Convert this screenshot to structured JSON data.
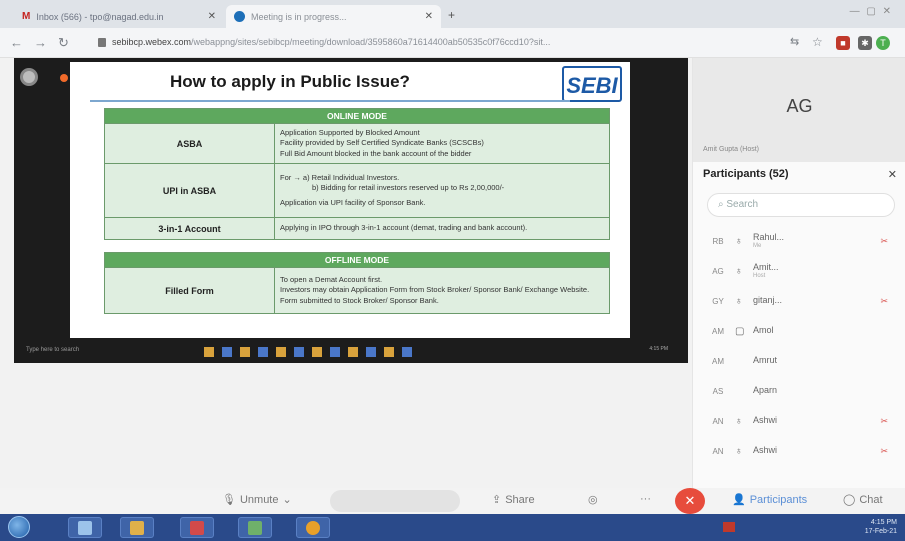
{
  "browser": {
    "tabs": [
      {
        "label": "Inbox (566) - tpo@nagad.edu.in"
      },
      {
        "label": "Meeting is in progress..."
      }
    ],
    "url_host": "sebibcp.webex.com",
    "url_path": "/webappng/sites/sebibcp/meeting/download/3595860a71614400ab50535c0f76ccd10?sit...",
    "profile_initial": "T"
  },
  "slide": {
    "title": "How to apply in Public Issue?",
    "logo_text": "SEBI",
    "online": {
      "heading": "ONLINE MODE",
      "rows": [
        {
          "key": "ASBA",
          "lines": [
            "Application Supported by Blocked Amount",
            "Facility provided by Self Certified Syndicate Banks (SCSCBs)",
            "Full Bid Amount blocked in the bank account of the bidder"
          ]
        },
        {
          "key": "UPI in ASBA",
          "lines": [
            "For →  a)  Retail Individual Investors.",
            "b)  Bidding for retail investors reserved up to Rs 2,00,000/-",
            "Application via UPI facility of Sponsor Bank."
          ]
        },
        {
          "key": "3-in-1 Account",
          "lines": [
            "Applying in IPO through 3-in-1 account (demat, trading and bank account)."
          ]
        }
      ]
    },
    "offline": {
      "heading": "OFFLINE MODE",
      "rows": [
        {
          "key": "Filled Form",
          "lines": [
            "To open a Demat Account first.",
            "Investors may obtain Application Form from Stock Broker/ Sponsor Bank/ Exchange Website.",
            "Form submitted to Stock Broker/ Sponsor Bank."
          ]
        }
      ]
    },
    "inner_taskbar": {
      "search": "Type here to search",
      "clock": "4:15 PM"
    }
  },
  "panel": {
    "self_initials": "AG",
    "self_name": "Amit Gupta (Host)",
    "title": "Participants (52)",
    "search_placeholder": "Search",
    "participants": [
      {
        "initials": "RB",
        "name": "Rahul...",
        "sub": "Me",
        "muted": true
      },
      {
        "initials": "AG",
        "name": "Amit...",
        "sub": "Host",
        "muted": false
      },
      {
        "initials": "GY",
        "name": "gitanj...",
        "sub": "",
        "muted": true
      },
      {
        "initials": "AM",
        "name": "Amol",
        "sub": "",
        "muted": false
      },
      {
        "initials": "AM",
        "name": "Amrut",
        "sub": "",
        "muted": false
      },
      {
        "initials": "AS",
        "name": "Aparn",
        "sub": "",
        "muted": false
      },
      {
        "initials": "AN",
        "name": "Ashwi",
        "sub": "",
        "muted": true
      },
      {
        "initials": "AN",
        "name": "Ashwi",
        "sub": "",
        "muted": true
      }
    ]
  },
  "controls": {
    "unmute": "Unmute",
    "share": "Share",
    "participants": "Participants",
    "chat": "Chat",
    "end_icon": "✕"
  },
  "taskbar": {
    "time": "4:15 PM",
    "date": "17-Feb-21"
  }
}
